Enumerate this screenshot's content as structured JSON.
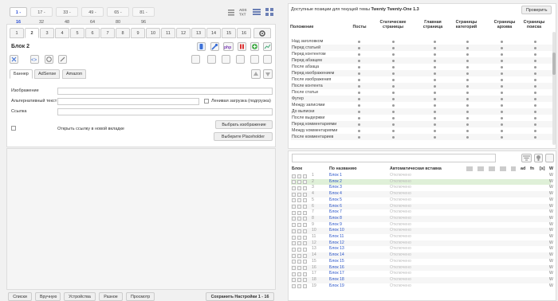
{
  "pagination": [
    "1 - 16",
    "17 - 32",
    "33 - 48",
    "49 - 64",
    "65 - 80",
    "81 - 96"
  ],
  "top_icons": [
    "list-icon",
    "ads-txt-icon",
    "rows-icon",
    "grid-icon"
  ],
  "tabs": [
    "1",
    "2",
    "3",
    "4",
    "5",
    "6",
    "7",
    "8",
    "9",
    "10",
    "11",
    "12",
    "13",
    "14",
    "15",
    "16"
  ],
  "active_tab": "2",
  "block_title": "Блок 2",
  "sub_tabs": [
    "Баннер",
    "AdSense",
    "Amazon"
  ],
  "form": {
    "image_label": "Изображение",
    "alt_label": "Альтернативный текст",
    "lazy_label": "Ленивая загрузка (подгрузка)",
    "link_label": "Ссылка",
    "new_tab_label": "Открыть ссылку в новой вкладке",
    "choose_image": "Выбрать изображение",
    "choose_placeholder": "Выберите Placeholder"
  },
  "bottom_buttons": [
    "Списки",
    "Вручную",
    "Устройства",
    "Разное",
    "Просмотр"
  ],
  "save_button": "Сохранить Настройки 1 - 16",
  "positions_panel": {
    "title_prefix": "Доступные позиции для текущей темы",
    "theme_name": "Twenty Twenty-One 1.3",
    "check_button": "Проверить",
    "columns": [
      "Положение",
      "Посты",
      "Статические страницы",
      "Главная страница",
      "Страницы категорий",
      "Страницы архива",
      "Страницы поиска"
    ],
    "rows": [
      "Над заголовком",
      "Перед статьей",
      "Перед контентом",
      "Перед абзацем",
      "После абзаца",
      "Перед изображением",
      "После изображения",
      "После контента",
      "После статьи",
      "Футер",
      "Между записями",
      "До выписки",
      "После выдержки",
      "Перед комментариями",
      "Между комментариями",
      "После комментариев"
    ]
  },
  "blocks_table": {
    "headers": [
      "Блок",
      "По названию",
      "Автоматическая вставка"
    ],
    "right_headers": [
      "ad",
      "fn",
      "[s]",
      "W"
    ],
    "rows": [
      {
        "num": "1",
        "name": "Блок 1",
        "auto": "Отключено"
      },
      {
        "num": "2",
        "name": "Блок 2",
        "auto": "Отключено"
      },
      {
        "num": "3",
        "name": "Блок 3",
        "auto": "Отключено"
      },
      {
        "num": "4",
        "name": "Блок 4",
        "auto": "Отключено"
      },
      {
        "num": "5",
        "name": "Блок 5",
        "auto": "Отключено"
      },
      {
        "num": "6",
        "name": "Блок 6",
        "auto": "Отключено"
      },
      {
        "num": "7",
        "name": "Блок 7",
        "auto": "Отключено"
      },
      {
        "num": "8",
        "name": "Блок 8",
        "auto": "Отключено"
      },
      {
        "num": "9",
        "name": "Блок 9",
        "auto": "Отключено"
      },
      {
        "num": "10",
        "name": "Блок 10",
        "auto": "Отключено"
      },
      {
        "num": "11",
        "name": "Блок 11",
        "auto": "Отключено"
      },
      {
        "num": "12",
        "name": "Блок 12",
        "auto": "Отключено"
      },
      {
        "num": "13",
        "name": "Блок 13",
        "auto": "Отключено"
      },
      {
        "num": "14",
        "name": "Блок 14",
        "auto": "Отключено"
      },
      {
        "num": "15",
        "name": "Блок 15",
        "auto": "Отключено"
      },
      {
        "num": "16",
        "name": "Блок 16",
        "auto": "Отключено"
      },
      {
        "num": "17",
        "name": "Блок 17",
        "auto": "Отключено"
      },
      {
        "num": "18",
        "name": "Блок 18",
        "auto": "Отключено"
      },
      {
        "num": "19",
        "name": "Блок 19",
        "auto": "Отключено"
      }
    ],
    "col_w": "W"
  },
  "colors": {
    "accent": "#2a4fd6",
    "link": "#2b55c8",
    "highlight_row": "#dff0d8",
    "disabled_text": "#bdbdbd"
  }
}
